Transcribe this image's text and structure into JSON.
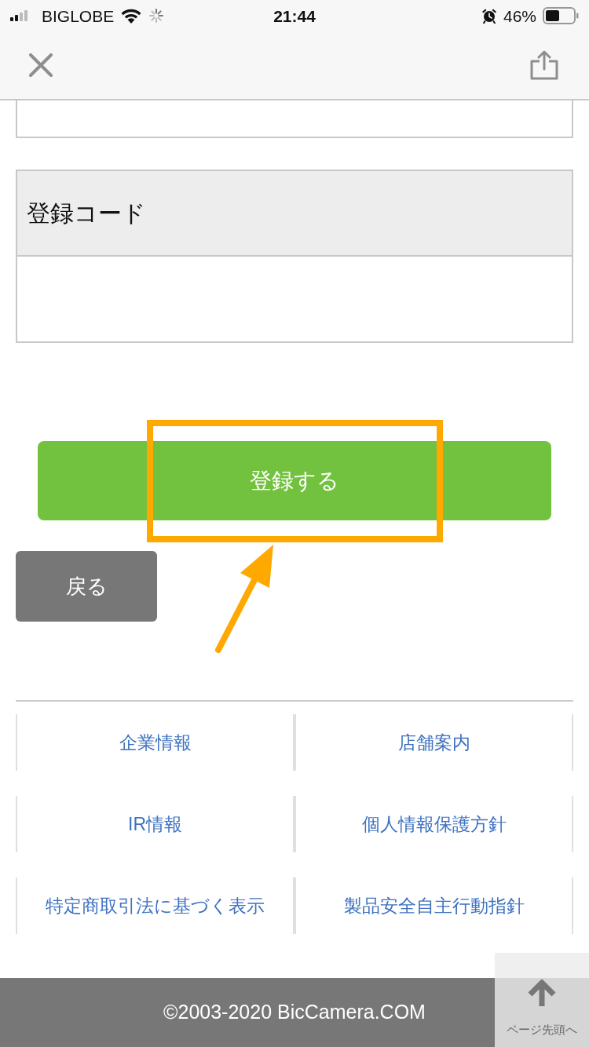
{
  "status_bar": {
    "carrier": "BIGLOBE",
    "time": "21:44",
    "battery": "46%"
  },
  "form": {
    "rows": [
      {
        "label": "登録コード"
      }
    ]
  },
  "buttons": [
    {
      "kind": "primary",
      "label": "登録する"
    },
    {
      "kind": "secondary",
      "label": "戻る"
    }
  ],
  "footer_links": [
    {
      "label": "企業情報"
    },
    {
      "label": "店舗案内"
    },
    {
      "label": "IR情報"
    },
    {
      "label": "個人情報保護方針"
    },
    {
      "label": "特定商取引法に基づく表示"
    },
    {
      "label": "製品安全自主行動指針"
    }
  ],
  "footer": {
    "copyright": "©2003-2020 BicCamera.COM"
  },
  "page_top_button": {
    "label": "ページ先頭へ"
  }
}
